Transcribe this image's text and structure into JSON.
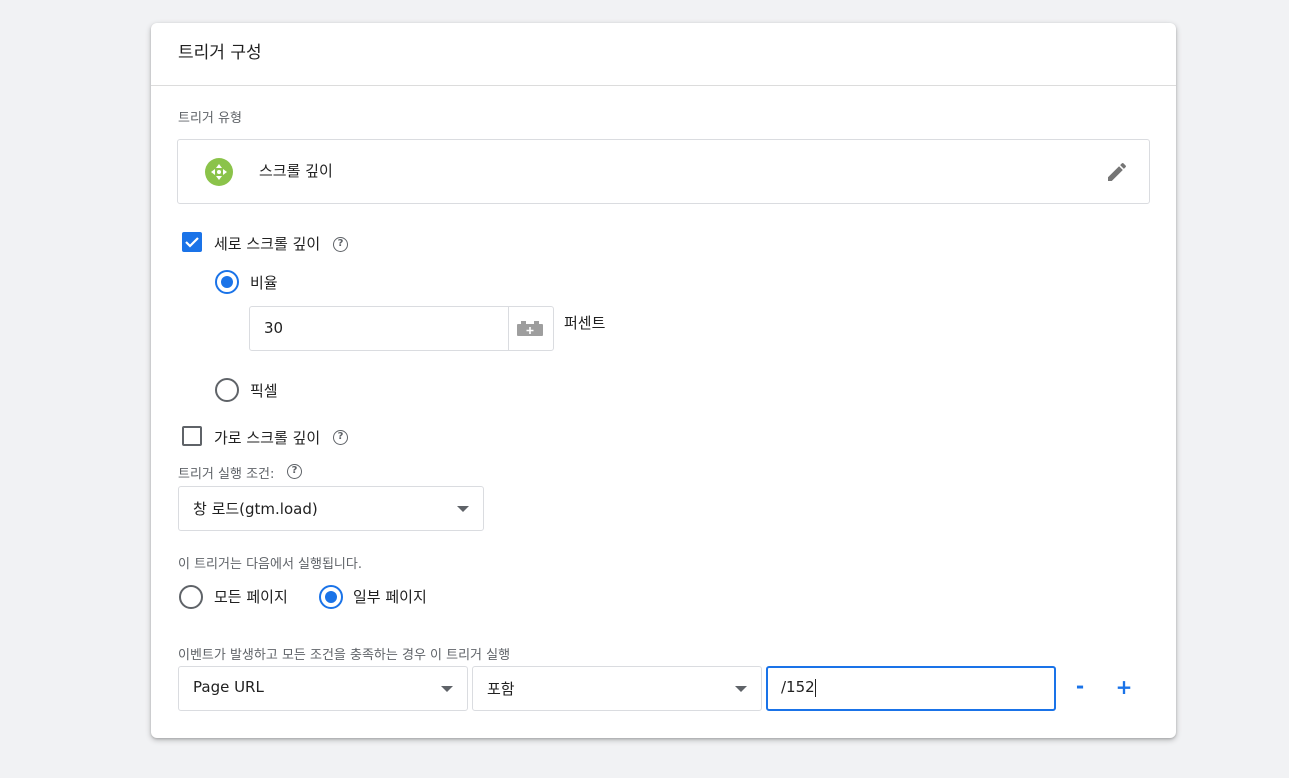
{
  "card": {
    "title": "트리거 구성",
    "trigger_type_label": "트리거 유형",
    "trigger_type_name": "스크롤 깊이",
    "trigger_type_icon": "scroll-move-icon",
    "edit_icon": "pencil-icon",
    "accent_color": "#1a73e8",
    "type_icon_color": "#8bc34a"
  },
  "vertical": {
    "label": "세로 스크롤 깊이",
    "checked": true,
    "percent_label": "비율",
    "percent_value": "30",
    "percent_unit": "퍼센트",
    "pixel_label": "픽셀",
    "selected": "비율"
  },
  "horizontal": {
    "label": "가로 스크롤 깊이",
    "checked": false
  },
  "fire_on": {
    "label": "트리거 실행 조건:",
    "selected": "창 로드(gtm.load)"
  },
  "scope": {
    "label": "이 트리거는 다음에서 실행됩니다.",
    "options": [
      "모든 페이지",
      "일부 페이지"
    ],
    "selected": "일부 페이지"
  },
  "condition": {
    "label": "이벤트가 발생하고 모든 조건을 충족하는 경우 이 트리거 실행",
    "variable": "Page URL",
    "operator": "포함",
    "value": "/152",
    "remove_label": "-",
    "add_label": "+"
  }
}
